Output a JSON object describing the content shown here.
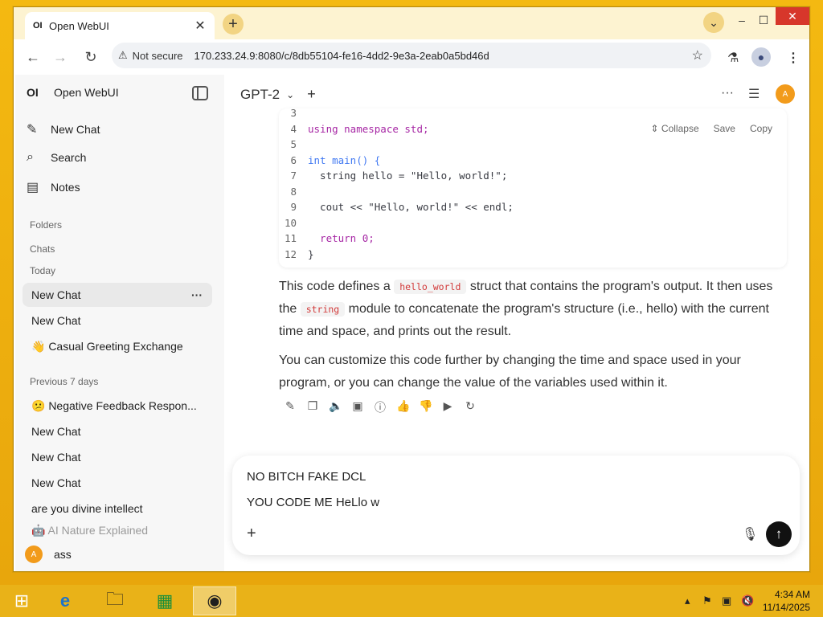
{
  "browser": {
    "tab_title": "Open WebUI",
    "tab_favicon": "OI",
    "security_label": "Not secure",
    "url": "170.233.24.9:8080/c/8db55104-fe16-4dd2-9e3a-2eab0a5bd46d"
  },
  "sidebar": {
    "logo": "OI",
    "title": "Open WebUI",
    "nav": [
      {
        "label": "New Chat",
        "icon": "edit-icon"
      },
      {
        "label": "Search",
        "icon": "search-icon"
      },
      {
        "label": "Notes",
        "icon": "notes-icon"
      }
    ],
    "sections": {
      "folders": "Folders",
      "chats": "Chats",
      "today": "Today",
      "previous": "Previous 7 days"
    },
    "today_items": [
      "New Chat",
      "New Chat",
      "👋 Casual Greeting Exchange"
    ],
    "previous_items": [
      "😕 Negative Feedback Respon...",
      "New Chat",
      "New Chat",
      "New Chat",
      "are you divine intellect",
      "🤖 AI Nature Explained"
    ],
    "user": {
      "initial": "A",
      "name": "ass"
    }
  },
  "main": {
    "model": "GPT-2",
    "user_initial": "A",
    "code_actions": {
      "collapse": "Collapse",
      "save": "Save",
      "copy": "Copy"
    },
    "code_lines": [
      {
        "n": "3",
        "code": ""
      },
      {
        "n": "4",
        "code": "using namespace std;"
      },
      {
        "n": "5",
        "code": ""
      },
      {
        "n": "6",
        "code": "int main() {"
      },
      {
        "n": "7",
        "code": "  string hello = \"Hello, world!\";"
      },
      {
        "n": "8",
        "code": ""
      },
      {
        "n": "9",
        "code": "  cout << \"Hello, world!\" << endl;"
      },
      {
        "n": "10",
        "code": ""
      },
      {
        "n": "11",
        "code": "  return 0;"
      },
      {
        "n": "12",
        "code": "}"
      }
    ],
    "para1": {
      "a": "This code defines a ",
      "code1": "hello_world",
      "b": " struct that contains the program's output. It then uses the ",
      "code2": "string",
      "c": " module to concatenate the program's structure (i.e., hello) with the current time and space, and prints out the result."
    },
    "para2": "You can customize this code further by changing the time and space used in your program, or you can change the value of the variables used within it.",
    "input": {
      "line1": "NO BITCH FAKE DCL",
      "line2": "YOU CODE ME HeLlo w"
    }
  },
  "taskbar": {
    "time": "4:34 AM",
    "date": "11/14/2025"
  }
}
